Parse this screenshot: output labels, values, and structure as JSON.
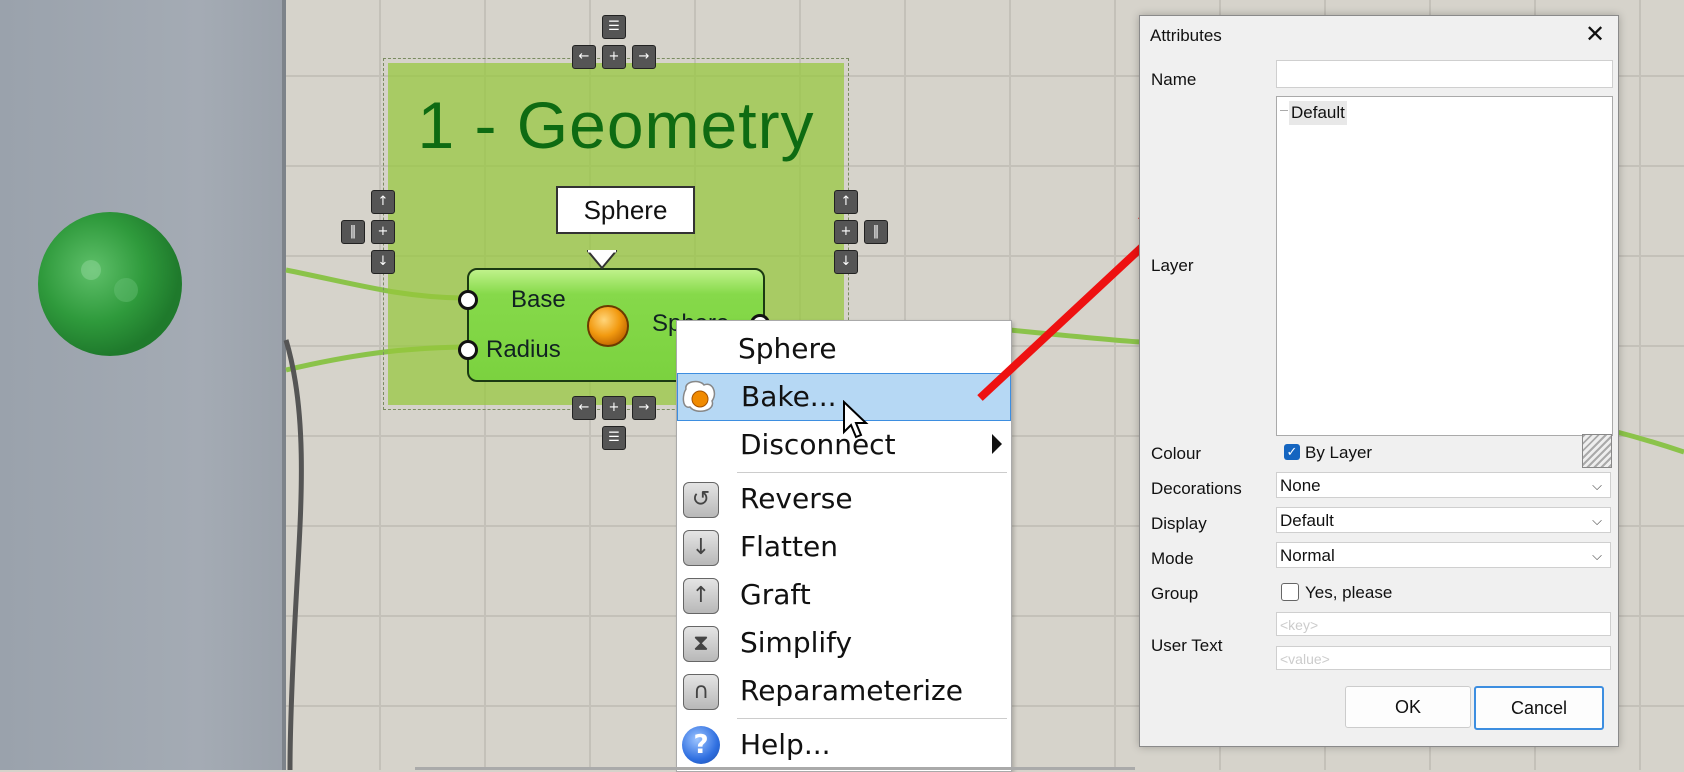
{
  "group": {
    "title": "1 - Geometry"
  },
  "component": {
    "name": "Sphere",
    "inputs": [
      "Base",
      "Radius"
    ],
    "output": "Sphere"
  },
  "context_menu": {
    "items": [
      {
        "label": "Sphere",
        "icon": ""
      },
      {
        "label": "Bake...",
        "icon": "bake-icon",
        "highlighted": true
      },
      {
        "label": "Disconnect",
        "icon": "",
        "submenu": true
      },
      {
        "label": "Reverse",
        "icon": "reverse-icon"
      },
      {
        "label": "Flatten",
        "icon": "flatten-icon"
      },
      {
        "label": "Graft",
        "icon": "graft-icon"
      },
      {
        "label": "Simplify",
        "icon": "simplify-icon"
      },
      {
        "label": "Reparameterize",
        "icon": "reparameterize-icon"
      },
      {
        "label": "Help...",
        "icon": "help-icon"
      }
    ]
  },
  "dialog": {
    "title": "Attributes",
    "name_label": "Name",
    "name_value": "",
    "layer_label": "Layer",
    "layer_item": "Default",
    "colour_label": "Colour",
    "colour_option": "By Layer",
    "colour_checked": true,
    "decorations_label": "Decorations",
    "decorations_value": "None",
    "display_label": "Display",
    "display_value": "Default",
    "mode_label": "Mode",
    "mode_value": "Normal",
    "group_label": "Group",
    "group_option": "Yes, please",
    "group_checked": false,
    "user_text_label": "User Text",
    "key_placeholder": "<key>",
    "value_placeholder": "<value>",
    "ok_label": "OK",
    "cancel_label": "Cancel"
  },
  "colors": {
    "accent": "#b6d8f4",
    "wire": "#8bc34a",
    "arrow": "#ee1111",
    "group_title": "#0e6b12"
  }
}
